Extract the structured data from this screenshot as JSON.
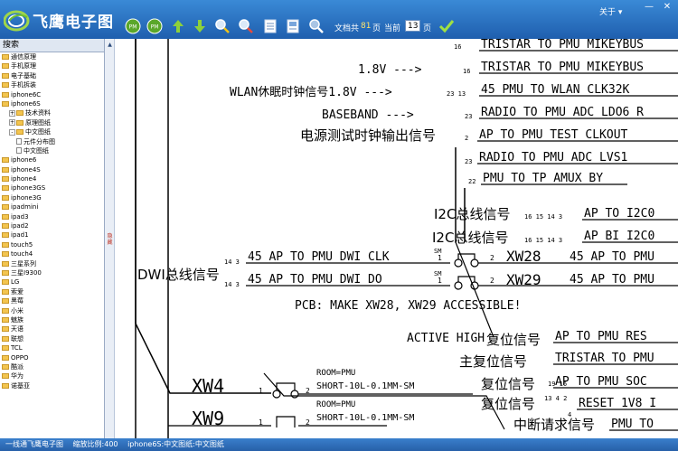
{
  "app": {
    "title": "飞鹰电子图",
    "about": "关于",
    "window_min": "—",
    "window_close": "✕"
  },
  "toolbar": {
    "doc_total_label": "文档共",
    "doc_total_value": "81",
    "page_unit": "页",
    "current_label": "当前",
    "current_value": "13",
    "current_unit": "页",
    "icons": [
      "prev-page-icon",
      "next-page-icon",
      "arrow-up-icon",
      "arrow-down-icon",
      "zoom-in-icon",
      "zoom-out-icon",
      "page-icon",
      "fit-page-icon",
      "search-icon",
      "confirm-icon"
    ]
  },
  "sidebar": {
    "search_label": "搜索",
    "items": [
      {
        "label": "通信原理",
        "type": "folder",
        "indent": 0
      },
      {
        "label": "手机原理",
        "type": "folder",
        "indent": 0
      },
      {
        "label": "电子基础",
        "type": "folder",
        "indent": 0
      },
      {
        "label": "手机拆装",
        "type": "folder",
        "indent": 0
      },
      {
        "label": "iphone6C",
        "type": "folder",
        "indent": 0
      },
      {
        "label": "iphone6S",
        "type": "folder",
        "indent": 0
      },
      {
        "label": "技术资料",
        "type": "folder",
        "indent": 1,
        "toggle": "+"
      },
      {
        "label": "原理图纸",
        "type": "folder",
        "indent": 1,
        "toggle": "+"
      },
      {
        "label": "中文图纸",
        "type": "folder",
        "indent": 1,
        "toggle": "-"
      },
      {
        "label": "元件分布图",
        "type": "doc",
        "indent": 2
      },
      {
        "label": "中文图纸",
        "type": "doc",
        "indent": 2
      },
      {
        "label": "iphone6",
        "type": "folder",
        "indent": 0
      },
      {
        "label": "iphone4S",
        "type": "folder",
        "indent": 0
      },
      {
        "label": "iphone4",
        "type": "folder",
        "indent": 0
      },
      {
        "label": "iphone3GS",
        "type": "folder",
        "indent": 0
      },
      {
        "label": "iphone3G",
        "type": "folder",
        "indent": 0
      },
      {
        "label": "ipadmini",
        "type": "folder",
        "indent": 0
      },
      {
        "label": "ipad3",
        "type": "folder",
        "indent": 0
      },
      {
        "label": "ipad2",
        "type": "folder",
        "indent": 0
      },
      {
        "label": "ipad1",
        "type": "folder",
        "indent": 0
      },
      {
        "label": "touch5",
        "type": "folder",
        "indent": 0
      },
      {
        "label": "touch4",
        "type": "folder",
        "indent": 0
      },
      {
        "label": "三星系列",
        "type": "folder",
        "indent": 0
      },
      {
        "label": "三星I9300",
        "type": "folder",
        "indent": 0
      },
      {
        "label": "LG",
        "type": "folder",
        "indent": 0
      },
      {
        "label": "索爱",
        "type": "folder",
        "indent": 0
      },
      {
        "label": "黑莓",
        "type": "folder",
        "indent": 0
      },
      {
        "label": "小米",
        "type": "folder",
        "indent": 0
      },
      {
        "label": "魅族",
        "type": "folder",
        "indent": 0
      },
      {
        "label": "天语",
        "type": "folder",
        "indent": 0
      },
      {
        "label": "联想",
        "type": "folder",
        "indent": 0
      },
      {
        "label": "TCL",
        "type": "folder",
        "indent": 0
      },
      {
        "label": "OPPO",
        "type": "folder",
        "indent": 0
      },
      {
        "label": "酷派",
        "type": "folder",
        "indent": 0
      },
      {
        "label": "华为",
        "type": "folder",
        "indent": 0
      },
      {
        "label": "诺基亚",
        "type": "folder",
        "indent": 0
      }
    ],
    "splitter_label": "隐藏"
  },
  "schematic": {
    "signals_right": [
      {
        "pins": "16",
        "name": "TRISTAR_TO_PMU_MIKEYBUS"
      },
      {
        "pins": "16",
        "name": "TRISTAR_TO_PMU_MIKEYBUS"
      },
      {
        "pins": "23 13",
        "name": "45_PMU_TO_WLAN_CLK32K"
      },
      {
        "pins": "23",
        "name": "RADIO_TO_PMU_ADC_LDO6_R"
      },
      {
        "pins": "2",
        "name": "AP_TO_PMU_TEST_CLKOUT"
      },
      {
        "pins": "23",
        "name": "RADIO_TO_PMU_ADC_LVS1"
      },
      {
        "pins": "22",
        "name": "PMU_TO_TP_AMUX_BY"
      }
    ],
    "left_labels": [
      {
        "text": "1.8V --->"
      },
      {
        "text": "WLAN休眠时钟信号1.8V --->"
      },
      {
        "text": "BASEBAND --->"
      },
      {
        "text": "电源测试时钟输出信号"
      }
    ],
    "i2c": [
      {
        "label": "I2C总线信号",
        "pins": "16 15 14 3",
        "name": "AP_TO_I2C0"
      },
      {
        "label": "I2C总线信号",
        "pins": "16 15 14 3",
        "name": "AP_BI_I2C0"
      }
    ],
    "dwi": {
      "label": "DWI总线信号",
      "row1": {
        "pins_left": "14 3",
        "net": "45_AP_TO_PMU_DWI_CLK",
        "sm": "SM",
        "p1": "1",
        "p2": "2",
        "part": "XW28",
        "out": "45_AP_TO_PMU"
      },
      "row2": {
        "pins_left": "14 3",
        "net": "45_AP_TO_PMU_DWI_DO",
        "sm": "SM",
        "p1": "1",
        "p2": "2",
        "part": "XW29",
        "out": "45_AP_TO_PMU"
      },
      "note": "PCB: MAKE XW28, XW29 ACCESSIBLE!"
    },
    "reset": {
      "active": "ACTIVE HIGH",
      "labels": [
        {
          "text": "复位信号",
          "name": "AP_TO_PMU_RES"
        },
        {
          "text": "主复位信号",
          "name": "TRISTAR_TO_PMU"
        },
        {
          "text": "复位信号",
          "name": "AP_TO_PMU_SOC"
        },
        {
          "text": "复位信号",
          "pins": "13 4 2",
          "name": "RESET_1V8_I"
        },
        {
          "text": "中断请求信号",
          "name": "PMU_TO"
        }
      ],
      "extra_pins": [
        "19 16",
        "4"
      ]
    },
    "parts": [
      {
        "ref": "XW4",
        "room": "ROOM=PMU",
        "desc": "SHORT-10L-0.1MM-SM",
        "p1": "1",
        "p2": "2"
      },
      {
        "ref": "XW9",
        "room": "ROOM=PMU",
        "desc": "SHORT-10L-0.1MM-SM",
        "p1": "1",
        "p2": "2"
      }
    ]
  },
  "status": {
    "app": "一线通飞鹰电子图",
    "zoom": "缩放比例:400",
    "path": "iphone6S:中文图纸:中文图纸"
  },
  "colors": {
    "topbar": "#2a6fc0",
    "statusbar": "#2f6dba",
    "folder": "#f3c54f",
    "ink": "#000000"
  }
}
